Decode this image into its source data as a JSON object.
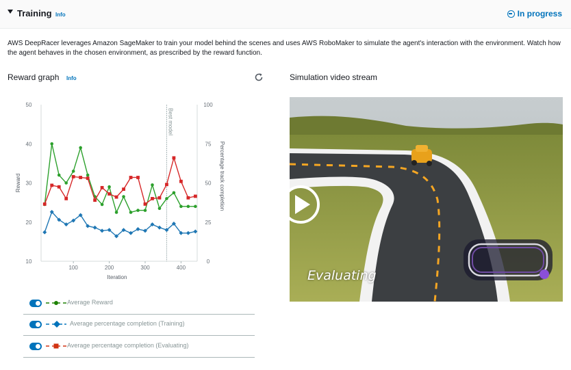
{
  "header": {
    "title": "Training",
    "info_label": "Info",
    "status": "In progress"
  },
  "description": "AWS DeepRacer leverages Amazon SageMaker to train your model behind the scenes and uses AWS RoboMaker to simulate the agent's interaction with the environment. Watch how the agent behaves in the chosen environment, as prescribed by the reward function.",
  "reward_graph": {
    "title": "Reward graph",
    "info_label": "Info"
  },
  "legend": [
    {
      "label": "Average Reward",
      "color": "#1d8102",
      "marker": "circle"
    },
    {
      "label": "Average percentage completion (Training)",
      "color": "#1f77b4",
      "marker": "diamond"
    },
    {
      "label": "Average percentage completion (Evaluating)",
      "color": "#d62728",
      "marker": "square"
    }
  ],
  "chart_data": {
    "type": "line",
    "xlabel": "Iteration",
    "ylabel": "Reward",
    "y2label": "Percentage track completion",
    "xlim": [
      10,
      445
    ],
    "xticks": [
      100,
      200,
      300,
      400
    ],
    "ylim": [
      10,
      50
    ],
    "yticks": [
      10,
      20,
      30,
      40,
      50
    ],
    "y2lim": [
      0,
      100
    ],
    "y2ticks": [
      0,
      25,
      50,
      75,
      100
    ],
    "annotation": {
      "label": "Best model",
      "x": 360
    },
    "series": [
      {
        "name": "Average Reward",
        "axis": "left",
        "color": "#2ca02c",
        "marker": "circle",
        "x": [
          20,
          40,
          60,
          80,
          100,
          120,
          140,
          160,
          180,
          200,
          220,
          240,
          260,
          280,
          300,
          320,
          340,
          360,
          380,
          400,
          420,
          440
        ],
        "values": [
          24.5,
          40,
          32,
          30,
          33,
          39,
          32,
          26.5,
          24.5,
          29,
          22.5,
          26.5,
          22.5,
          23,
          23,
          29.5,
          23.5,
          26,
          27.5,
          24,
          24,
          24
        ]
      },
      {
        "name": "Average percentage completion (Training)",
        "axis": "right",
        "color": "#1f77b4",
        "marker": "diamond",
        "x": [
          20,
          40,
          60,
          80,
          100,
          120,
          140,
          160,
          180,
          200,
          220,
          240,
          260,
          280,
          300,
          320,
          340,
          360,
          380,
          400,
          420,
          440
        ],
        "values": [
          18.5,
          31.5,
          26.5,
          23.5,
          26,
          29.5,
          22.5,
          21.5,
          19.5,
          20,
          16,
          20,
          18,
          20.5,
          19.5,
          23.5,
          21.5,
          20,
          24,
          18,
          18,
          19
        ]
      },
      {
        "name": "Average percentage completion (Evaluating)",
        "axis": "right",
        "color": "#d62728",
        "marker": "square",
        "x": [
          20,
          40,
          60,
          80,
          100,
          120,
          140,
          160,
          180,
          200,
          220,
          240,
          260,
          280,
          300,
          320,
          340,
          360,
          380,
          400,
          420,
          440
        ],
        "values": [
          36.5,
          48.5,
          47.5,
          40,
          54,
          53.5,
          53,
          39,
          47,
          43,
          41,
          46,
          53.5,
          53.5,
          36.5,
          40,
          40.5,
          49,
          66,
          51,
          40.5,
          41.5
        ]
      }
    ]
  },
  "video": {
    "title": "Simulation video stream",
    "overlay_text": "Evaluating"
  }
}
